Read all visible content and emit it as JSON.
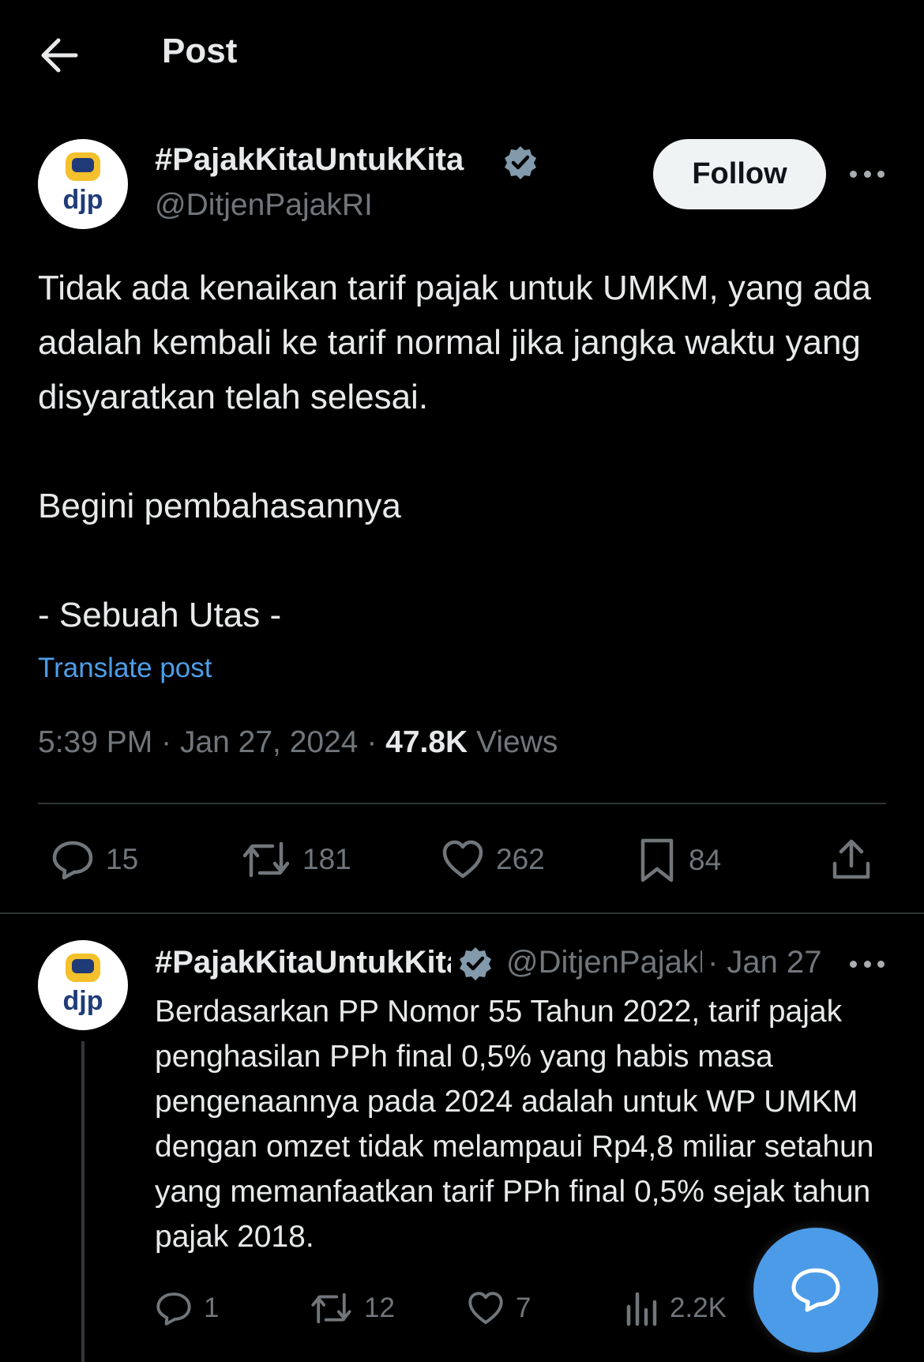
{
  "header": {
    "title": "Post"
  },
  "post": {
    "author_name": "#PajakKitaUntukKita",
    "handle": "@DitjenPajakRI",
    "avatar_text": "djp",
    "follow_label": "Follow",
    "body": {
      "line1": "Tidak ada kenaikan tarif pajak untuk UMKM, yang ada adalah kembali ke tarif normal jika jangka waktu yang disyaratkan telah selesai.",
      "line2": "Begini pembahasannya",
      "line3": "- Sebuah Utas -"
    },
    "translate_label": "Translate post",
    "time": "5:39 PM",
    "separator": "·",
    "date": "Jan 27, 2024",
    "views_count": "47.8K",
    "views_label": "Views",
    "stats": {
      "replies": "15",
      "reposts": "181",
      "likes": "262",
      "bookmarks": "84"
    }
  },
  "reply": {
    "author_name": "#PajakKitaUntukKita",
    "handle": "@DitjenPajakRI",
    "avatar_text": "djp",
    "date": "· Jan 27",
    "body": "Berdasarkan PP Nomor 55 Tahun 2022, tarif pajak penghasilan PPh final 0,5% yang habis masa pengenaannya pada 2024 adalah untuk WP UMKM dengan omzet tidak melampaui Rp4,8 miliar setahun yang memanfaatkan tarif PPh final 0,5% sejak tahun pajak 2018.",
    "stats": {
      "replies": "1",
      "reposts": "12",
      "likes": "7",
      "views": "2.2K"
    }
  },
  "colors": {
    "accent": "#4c9be8",
    "verified": "#829aab",
    "muted": "#71767b",
    "text": "#e7e9ea"
  }
}
